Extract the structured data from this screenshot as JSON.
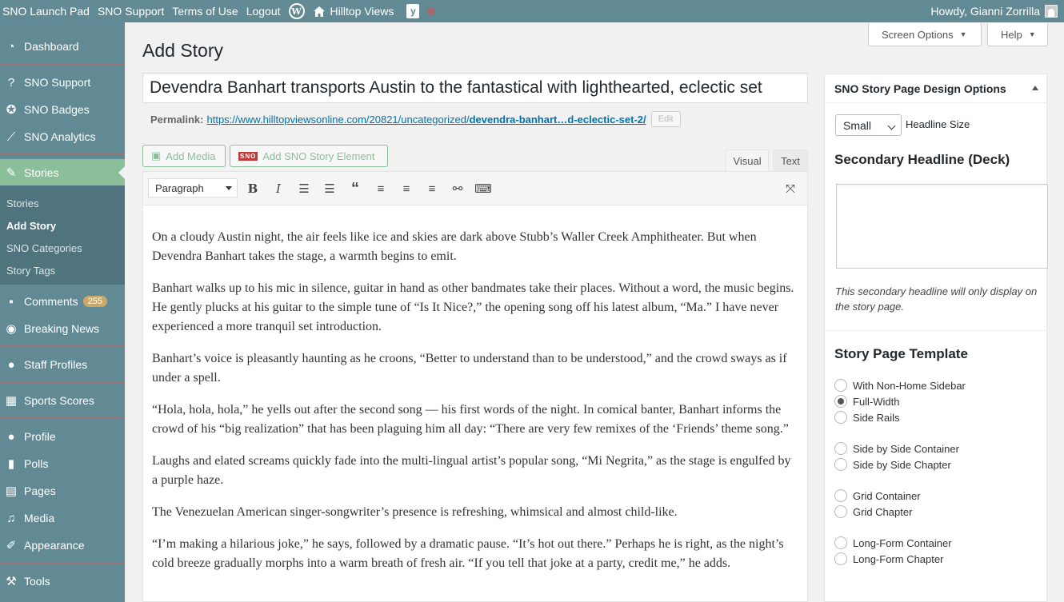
{
  "adminbar": {
    "items": [
      "SNO Launch Pad",
      "SNO Support",
      "Terms of Use",
      "Logout"
    ],
    "site_name": "Hilltop Views",
    "howdy": "Howdy, Gianni Zorrilla"
  },
  "sidebar": {
    "items": [
      {
        "label": "Dashboard",
        "icon": "dashboard-icon"
      },
      {
        "label": "SNO Support",
        "icon": "help-icon"
      },
      {
        "label": "SNO Badges",
        "icon": "badge-icon"
      },
      {
        "label": "SNO Analytics",
        "icon": "analytics-icon"
      },
      {
        "label": "Stories",
        "icon": "pin-icon"
      },
      {
        "label": "Comments",
        "icon": "comment-icon",
        "count": "255"
      },
      {
        "label": "Breaking News",
        "icon": "broadcast-icon"
      },
      {
        "label": "Staff Profiles",
        "icon": "user-icon"
      },
      {
        "label": "Sports Scores",
        "icon": "calendar-icon"
      },
      {
        "label": "Profile",
        "icon": "user-icon"
      },
      {
        "label": "Polls",
        "icon": "chart-icon"
      },
      {
        "label": "Pages",
        "icon": "pages-icon"
      },
      {
        "label": "Media",
        "icon": "media-icon"
      },
      {
        "label": "Appearance",
        "icon": "brush-icon"
      },
      {
        "label": "Tools",
        "icon": "wrench-icon"
      }
    ],
    "submenu": [
      "Stories",
      "Add Story",
      "SNO Categories",
      "Story Tags"
    ]
  },
  "header": {
    "title": "Add Story",
    "screen_options": "Screen Options",
    "help": "Help"
  },
  "editor": {
    "title_value": "Devendra Banhart transports Austin to the fantastical with lighthearted, eclectic set",
    "permalink_label": "Permalink:",
    "permalink_base": "https://www.hilltopviewsonline.com/20821/uncategorized/",
    "permalink_slug": "devendra-banhart…d-eclectic-set-2/",
    "edit_label": "Edit",
    "add_media": "Add Media",
    "add_sno": "Add SNO Story Element",
    "sno_logo": "SNO",
    "tab_visual": "Visual",
    "tab_text": "Text",
    "format": "Paragraph",
    "paragraphs": [
      "On a cloudy Austin night, the air feels like ice and skies are dark above Stubb’s Waller Creek Amphitheater. But when Devendra Banhart takes the stage, a warmth begins to emit.",
      "Banhart walks up to his mic in silence, guitar in hand as other bandmates take their places. Without a word, the music begins. He gently plucks at his guitar to the simple tune of “Is It Nice?,” the opening song off his latest album, “Ma.” I have never experienced a more tranquil set introduction.",
      "Banhart’s voice is pleasantly haunting as he croons, “Better to understand than to be understood,” and the crowd sways as if under a spell.",
      "“Hola, hola, hola,” he yells out after the second song —  his first words of the night. In comical banter, Banhart informs the crowd of his “big realization” that has been plaguing him all day: “There are very few remixes of the ‘Friends’ theme song.”",
      "Laughs and elated screams quickly fade into the multi-lingual artist’s popular song, “Mi Negrita,” as the stage is engulfed by a purple haze.",
      "The Venezuelan American singer-songwriter’s presence is refreshing, whimsical and almost child-like.",
      "“I’m making a hilarious joke,” he says, followed by a dramatic pause. “It’s hot out there.” Perhaps he is right, as the night’s cold breeze gradually morphs into a warm breath of fresh air. “If you tell that joke at a party, credit me,” he adds."
    ]
  },
  "panel": {
    "title": "SNO Story Page Design Options",
    "headline_size_value": "Small",
    "headline_size_label": "Headline Size",
    "deck_heading": "Secondary Headline (Deck)",
    "deck_note": "This secondary headline will only display on the story page.",
    "template_heading": "Story Page Template",
    "templates": [
      {
        "label": "With Non-Home Sidebar",
        "checked": false
      },
      {
        "label": "Full-Width",
        "checked": true
      },
      {
        "label": "Side Rails",
        "checked": false
      },
      {
        "label": "Side by Side Container",
        "checked": false
      },
      {
        "label": "Side by Side Chapter",
        "checked": false
      },
      {
        "label": "Grid Container",
        "checked": false
      },
      {
        "label": "Grid Chapter",
        "checked": false
      },
      {
        "label": "Long-Form Container",
        "checked": false
      },
      {
        "label": "Long-Form Chapter",
        "checked": false
      }
    ]
  },
  "colors": {
    "admin_bar": "#628a94",
    "sidebar": "#628a94",
    "active_menu": "#8bbf9a",
    "link": "#0073aa"
  }
}
